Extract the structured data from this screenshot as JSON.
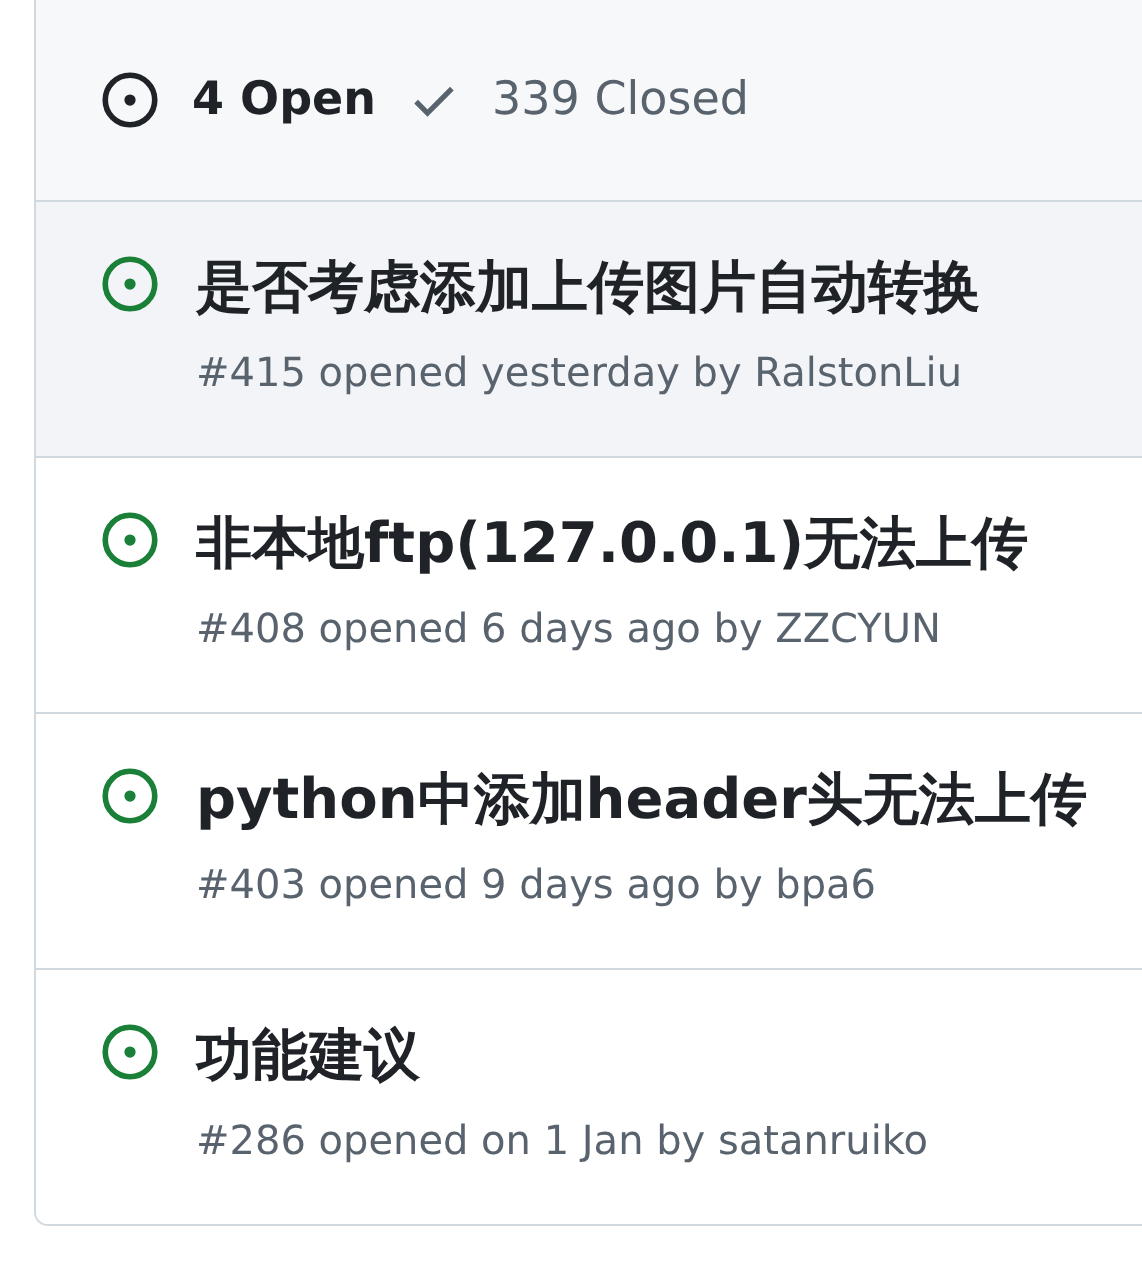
{
  "header": {
    "open_count": "4 Open",
    "closed_count": "339 Closed",
    "open_selected": true
  },
  "issues": [
    {
      "title": "是否考虑添加上传图片自动转换",
      "meta": "#415 opened yesterday by RalstonLiu",
      "hovered": true
    },
    {
      "title": "非本地ftp(127.0.0.1)无法上传",
      "meta": "#408 opened 6 days ago by ZZCYUN",
      "hovered": false
    },
    {
      "title": "python中添加header头无法上传",
      "meta": "#403 opened 9 days ago by bpa6",
      "hovered": false
    },
    {
      "title": "功能建议",
      "meta": "#286 opened on 1 Jan by satanruiko",
      "hovered": false
    }
  ]
}
